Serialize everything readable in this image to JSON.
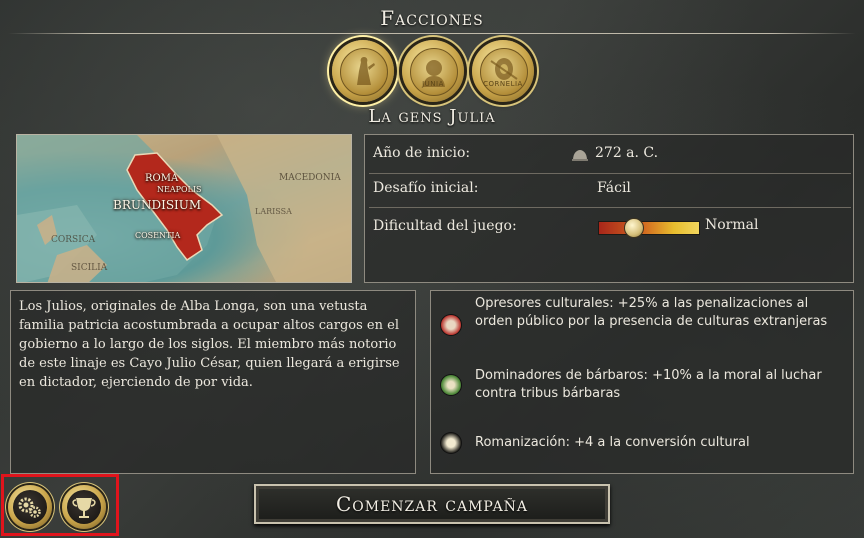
{
  "header": {
    "title": "Facciones",
    "faction_name": "La gens Julia"
  },
  "factions": [
    {
      "label": "",
      "icon": "goddess-coin-icon",
      "active": true
    },
    {
      "label": "JUNIA",
      "icon": "portrait-coin-icon",
      "active": false
    },
    {
      "label": "CORNELIA",
      "icon": "shield-coin-icon",
      "active": false
    }
  ],
  "map": {
    "labels": [
      "ROMA",
      "NEAPOLIS",
      "BRUNDISIUM",
      "COSENTIA",
      "CORSICA",
      "MACEDONIA",
      "LARISSA",
      "SICILIA"
    ]
  },
  "info": {
    "start_year_label": "Año de inicio:",
    "start_year_value": "272 a. C.",
    "challenge_label": "Desafío inicial:",
    "challenge_value": "Fácil",
    "difficulty_label": "Dificultad del juego:",
    "difficulty_value": "Normal",
    "difficulty_level": 0.3
  },
  "description": "Los Julios, originales de Alba Longa, son una vetusta familia patricia acostumbrada a ocupar altos cargos en el gobierno a lo largo de los siglos. El miembro más notorio de este linaje es Cayo Julio César, quien llegará a erigirse en dictador, ejerciendo de por vida.",
  "traits": [
    {
      "text": "Opresores culturales: +25% a las penalizaciones al orden público por la presencia de culturas extranjeras",
      "icon": "cultural-oppression-icon",
      "color": "#b8302a"
    },
    {
      "text": "Dominadores de bárbaros: +10% a la moral al luchar contra tribus bárbaras",
      "icon": "barbarian-dominator-icon",
      "color": "#4f8a3a"
    },
    {
      "text": "Romanización: +4 a la conversión cultural",
      "icon": "temple-icon",
      "color": "#c9b24a"
    }
  ],
  "buttons": {
    "start": "Comenzar campaña",
    "settings_icon": "gears-icon",
    "achievements_icon": "trophy-cup-icon"
  },
  "colors": {
    "highlight": "#e0141c",
    "gold": "#caa54a"
  }
}
